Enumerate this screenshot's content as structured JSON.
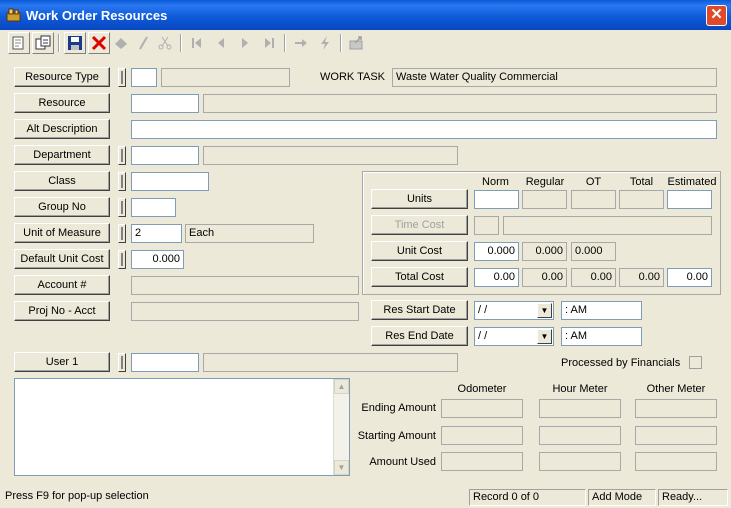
{
  "window": {
    "title": "Work Order Resources",
    "close_glyph": "✕"
  },
  "toolbar": {
    "buttons": [
      {
        "icon": "copy-record-icon",
        "enabled": true
      },
      {
        "icon": "new-window-icon",
        "enabled": true
      },
      {
        "icon": "save-icon",
        "enabled": true
      },
      {
        "icon": "delete-icon",
        "enabled": true
      },
      {
        "icon": "print-icon",
        "enabled": false
      },
      {
        "icon": "edit-icon",
        "enabled": false
      },
      {
        "icon": "cut-icon",
        "enabled": false
      },
      {
        "icon": "first-record-icon",
        "enabled": false
      },
      {
        "icon": "previous-record-icon",
        "enabled": false
      },
      {
        "icon": "next-record-icon",
        "enabled": false
      },
      {
        "icon": "last-record-icon",
        "enabled": false
      },
      {
        "icon": "goto-icon",
        "enabled": false
      },
      {
        "icon": "lightning-icon",
        "enabled": false
      },
      {
        "icon": "export-icon",
        "enabled": false
      }
    ]
  },
  "labels": {
    "resource_type": "Resource Type",
    "work_task": "WORK TASK",
    "resource": "Resource",
    "alt_description": "Alt Description",
    "department": "Department",
    "class": "Class",
    "group_no": "Group No",
    "unit_of_measure": "Unit of Measure",
    "default_unit_cost": "Default Unit Cost",
    "account": "Account #",
    "proj_no_acct": "Proj No - Acct",
    "user1": "User 1",
    "processed_by_financials": "Processed by Financials"
  },
  "values": {
    "resource_type_code": "",
    "resource_type_desc": "",
    "work_task": "Waste Water Quality Commercial",
    "resource_code": "",
    "resource_desc": "",
    "alt_description": "",
    "department_code": "",
    "department_desc": "",
    "class": "",
    "group_no": "",
    "uom_code": "2",
    "uom_desc": "Each",
    "default_unit_cost": "0.000",
    "account": "",
    "proj_no_acct": "",
    "user1_code": "",
    "user1_desc": ""
  },
  "costs": {
    "headers": {
      "norm": "Norm",
      "regular": "Regular",
      "ot": "OT",
      "total": "Total",
      "estimated": "Estimated"
    },
    "units_label": "Units",
    "time_cost_label": "Time Cost",
    "unit_cost_label": "Unit Cost",
    "total_cost_label": "Total Cost",
    "units": {
      "norm": "",
      "regular": "",
      "ot": "",
      "total": "",
      "estimated": ""
    },
    "unit_cost": {
      "norm": "0.000",
      "regular": "0.000",
      "ot": "0.000"
    },
    "total_cost": {
      "norm": "0.00",
      "regular": "0.00",
      "ot": "0.00",
      "total": "0.00",
      "estimated": "0.00"
    }
  },
  "dates": {
    "start_label": "Res Start Date",
    "end_label": "Res End Date",
    "start_date": " / /",
    "start_time": "  :  AM",
    "end_date": " / /",
    "end_time": "  :  AM"
  },
  "meters": {
    "headers": {
      "odometer": "Odometer",
      "hour_meter": "Hour Meter",
      "other_meter": "Other Meter"
    },
    "ending_amount": "Ending Amount",
    "starting_amount": "Starting Amount",
    "amount_used": "Amount Used"
  },
  "status": {
    "hint": "Press F9 for pop-up selection",
    "record": "Record 0 of 0",
    "mode": "Add Mode",
    "state": "Ready..."
  }
}
